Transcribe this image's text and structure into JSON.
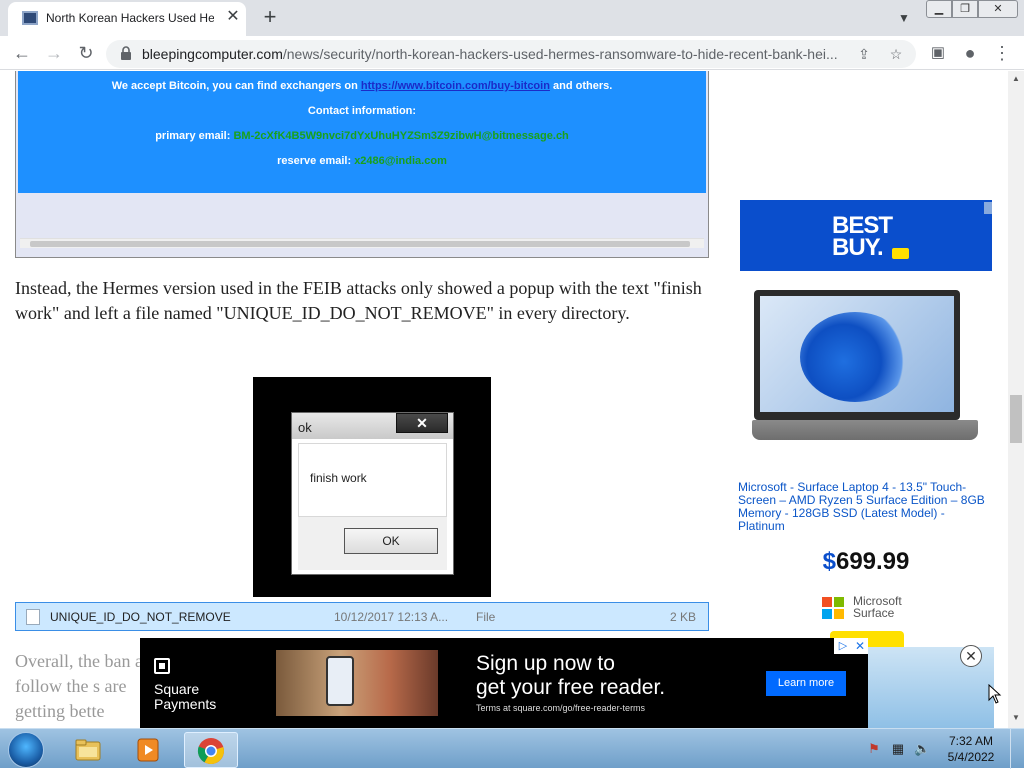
{
  "browser": {
    "tab_title": "North Korean Hackers Used Hermes Ransomware to Hide Recent Bank Heist",
    "tab_close": "✕",
    "new_tab": "+",
    "url_domain": "bleepingcomputer.com",
    "url_path": "/news/security/north-korean-hackers-used-hermes-ransomware-to-hide-recent-bank-hei..."
  },
  "ransom_note": {
    "bitcoin_prefix": "We accept Bitcoin,  you can find exchangers on",
    "bitcoin_link": "https://www.bitcoin.com/buy-bitcoin",
    "bitcoin_suffix": "and others.",
    "contact_label": "Contact information:",
    "primary_label": "primary email:",
    "primary_email": "BM-2cXfK4B5W9nvci7dYxUhuHYZSm3Z9zibwH@bitmessage.ch",
    "reserve_label": "reserve email:",
    "reserve_email": "x2486@india.com"
  },
  "article": {
    "paragraph": "Instead, the Hermes version used in the FEIB attacks only showed a popup with the text \"finish work\" and left a file named \"UNIQUE_ID_DO_NOT_REMOVE\" in every directory.",
    "faded_paragraph": "Overall, the ban and follow the s are getting bette"
  },
  "popup": {
    "title": "ok",
    "close": "✕",
    "message": "finish work",
    "ok_button": "OK"
  },
  "file_row": {
    "name": "UNIQUE_ID_DO_NOT_REMOVE",
    "date": "10/12/2017 12:13 A...",
    "type": "File",
    "size": "2 KB"
  },
  "sidebar_ad": {
    "brand_line1": "BEST",
    "brand_line2": "BUY.",
    "product_name": "Microsoft - Surface Laptop 4 - 13.5\" Touch-Screen – AMD Ryzen 5 Surface Edition – 8GB Memory - 128GB SSD (Latest Model) - Platinum",
    "price_currency": "$",
    "price_value": "699.99",
    "maker_line1": "Microsoft",
    "maker_line2": "Surface"
  },
  "square_ad": {
    "brand_line1": "Square",
    "brand_line2": "Payments",
    "headline_line1": "Sign up now to",
    "headline_line2": "get your free reader.",
    "terms": "Terms at square.com/go/free-reader-terms",
    "cta": "Learn more",
    "close": "✕"
  },
  "taskbar": {
    "time": "7:32 AM",
    "date": "5/4/2022"
  },
  "colors": {
    "ransom_blue": "#1e90ff",
    "link_blue": "#0b56c8",
    "bestbuy_blue": "#0a4ecc",
    "square_cta": "#006aff"
  }
}
